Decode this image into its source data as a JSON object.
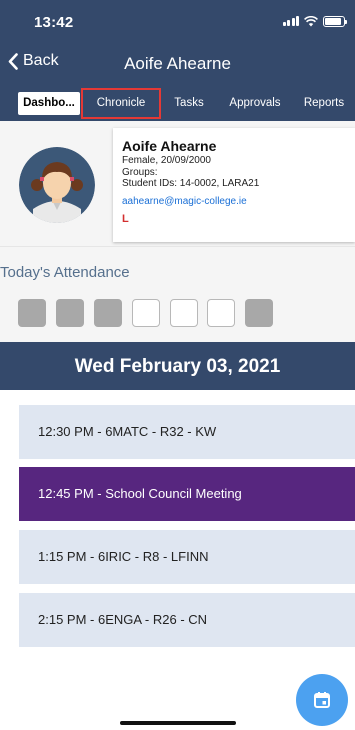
{
  "status_bar": {
    "time": "13:42",
    "battery_level": 0.9
  },
  "nav": {
    "back_label": "Back",
    "title": "Aoife Ahearne"
  },
  "tabs": [
    {
      "label": "Dashbo...",
      "active": true
    },
    {
      "label": "Chronicle",
      "active": false,
      "highlighted": true
    },
    {
      "label": "Tasks",
      "active": false
    },
    {
      "label": "Approvals",
      "active": false
    },
    {
      "label": "Reports",
      "active": false
    }
  ],
  "profile": {
    "name": "Aoife Ahearne",
    "gender_dob": "Female, 20/09/2000",
    "groups": "Groups:",
    "student_ids": "Student IDs: 14-0002, LARA21",
    "email": "aahearne@magic-college.ie",
    "badge": "L"
  },
  "attendance": {
    "title": "Today's Attendance",
    "slots": [
      "filled",
      "filled",
      "filled",
      "empty",
      "empty",
      "empty",
      "filled"
    ]
  },
  "date_header": "Wed February 03, 2021",
  "events": [
    {
      "label": "12:30 PM - 6MATC - R32 - KW",
      "highlight": false
    },
    {
      "label": "12:45 PM - School Council Meeting",
      "highlight": true
    },
    {
      "label": "1:15 PM - 6IRIC - R8 - LFINN",
      "highlight": false
    },
    {
      "label": "2:15 PM - 6ENGA - R26 - CN",
      "highlight": false
    }
  ],
  "fab": {
    "icon": "calendar-icon"
  },
  "colors": {
    "header": "#34496b",
    "event_default": "#dfe6f1",
    "event_highlight": "#57267f",
    "fab": "#4ca1f0",
    "highlight_border": "#e53935",
    "email": "#1a6fd6"
  }
}
